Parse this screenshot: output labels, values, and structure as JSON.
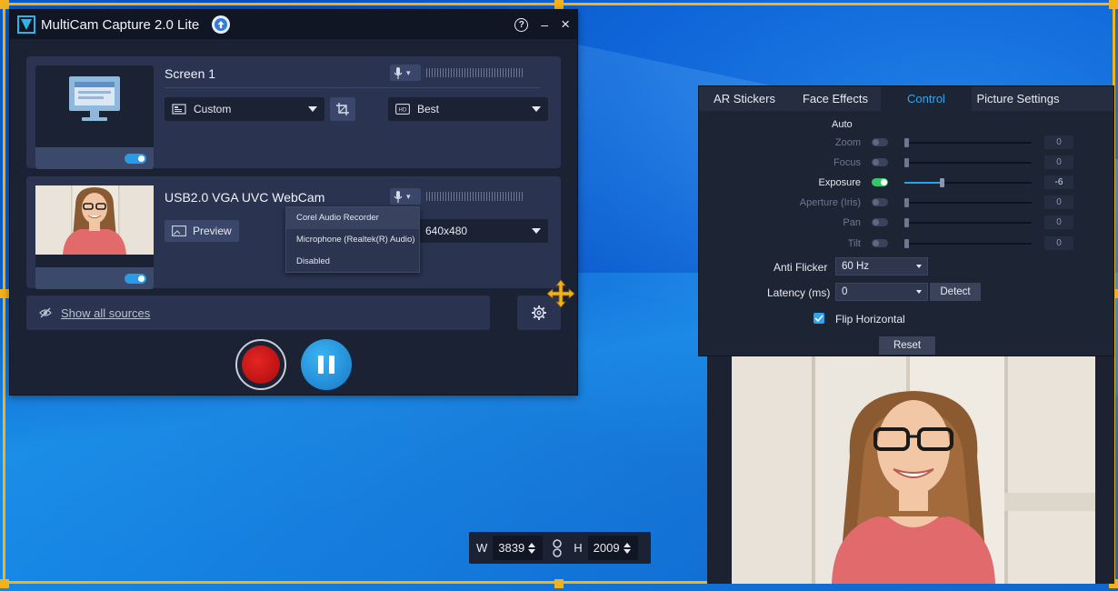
{
  "app": {
    "title": "MultiCam Capture 2.0 Lite",
    "help_label": "?",
    "minimize_label": "–",
    "close_label": "×"
  },
  "sources": [
    {
      "name": "Screen 1",
      "region_dropdown": "Custom",
      "quality_dropdown": "Best",
      "enabled": true
    },
    {
      "name": "USB2.0 VGA UVC WebCam",
      "preview_label": "Preview",
      "resolution_dropdown": "640x480",
      "enabled": true
    }
  ],
  "mic_menu": {
    "items": [
      "Corel Audio Recorder",
      "Microphone (Realtek(R) Audio)",
      "Disabled"
    ],
    "highlighted": "Corel Audio Recorder"
  },
  "show_sources_label": "Show all sources",
  "camera_panel": {
    "tabs": [
      "AR Stickers",
      "Face Effects",
      "Control",
      "Picture Settings"
    ],
    "active_tab": "Control",
    "auto_label": "Auto",
    "controls": [
      {
        "label": "Zoom",
        "value": "0",
        "enabled": false,
        "auto": false,
        "level": 0
      },
      {
        "label": "Focus",
        "value": "0",
        "enabled": false,
        "auto": false,
        "level": 0
      },
      {
        "label": "Exposure",
        "value": "-6",
        "enabled": true,
        "auto": true,
        "level": 0.28
      },
      {
        "label": "Aperture (Iris)",
        "value": "0",
        "enabled": false,
        "auto": false,
        "level": 0
      },
      {
        "label": "Pan",
        "value": "0",
        "enabled": false,
        "auto": false,
        "level": 0
      },
      {
        "label": "Tilt",
        "value": "0",
        "enabled": false,
        "auto": false,
        "level": 0
      }
    ],
    "anti_flicker_label": "Anti Flicker",
    "anti_flicker_value": "60 Hz",
    "latency_label": "Latency (ms)",
    "latency_value": "0",
    "detect_label": "Detect",
    "flip_label": "Flip Horizontal",
    "flip_checked": true,
    "reset_label": "Reset"
  },
  "dimensions": {
    "w_label": "W",
    "w_value": "3839",
    "h_label": "H",
    "h_value": "2009"
  },
  "colors": {
    "accent": "#2ea3ef",
    "record": "#d41b1b",
    "selection": "#f2b21b"
  }
}
